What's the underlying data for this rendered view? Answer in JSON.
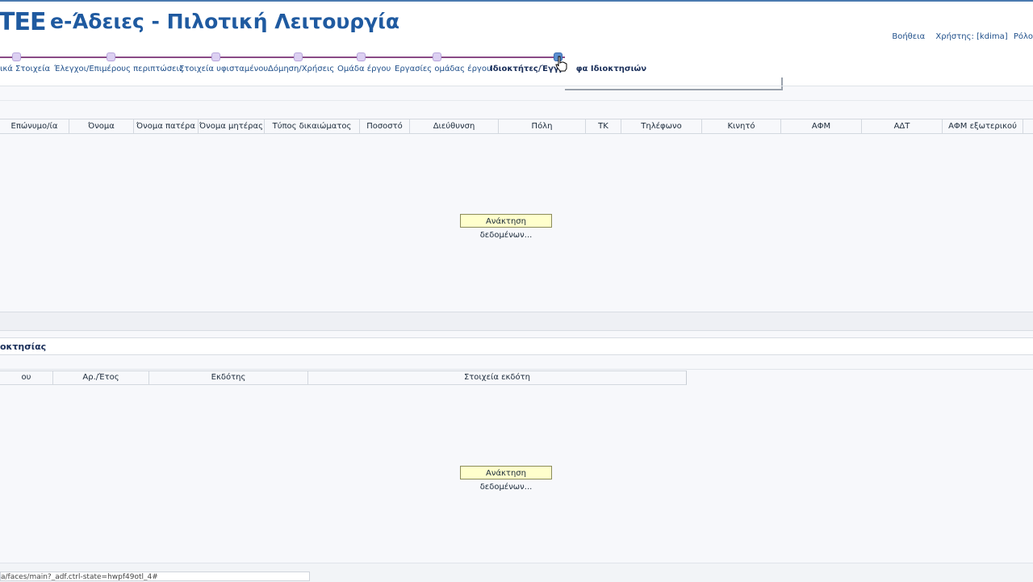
{
  "header": {
    "logo": "ΤΕΕ",
    "title": "e-Άδειες  - Πιλοτική Λειτουργία",
    "help_link": "Βοήθεια",
    "user": "Χρήστης: [kdima]",
    "role": "Ρόλο"
  },
  "train": {
    "stops": [
      {
        "label": "ικά Στοιχεία"
      },
      {
        "label": "Έλεγχοι/Επιμέρους περιπτώσεις"
      },
      {
        "label": "Στοιχεία υφισταμένου"
      },
      {
        "label": "Δόμηση/Χρήσεις"
      },
      {
        "label": "Ομάδα έργου"
      },
      {
        "label": "Εργασίες ομάδας έργου"
      },
      {
        "label": "Ιδιοκτήτες/Έγγρ",
        "label_tail": "φα Ιδιοκτησιών"
      }
    ]
  },
  "owners_table": {
    "columns": [
      "Επώνυμο/ία",
      "Όνομα",
      "Όνομα πατέρα",
      "Όνομα μητέρας",
      "Τύπος δικαιώματος",
      "Ποσοστό",
      "Διεύθυνση",
      "Πόλη",
      "ΤΚ",
      "Τηλέφωνο",
      "Κινητό",
      "ΑΦΜ",
      "ΑΔΤ",
      "ΑΦΜ εξωτερικού"
    ],
    "loading": "Ανάκτηση δεδομένων..."
  },
  "ownership_docs": {
    "title": "οκτησίας",
    "columns": [
      "ου",
      "Αρ./Έτος",
      "Εκδότης",
      "Στοιχεία εκδότη"
    ],
    "loading": "Ανάκτηση δεδομένων..."
  },
  "status_bar": {
    "url": "a/faces/main?_adf.ctrl-state=hwpf49otl_4#"
  },
  "colors": {
    "brand": "#1f5aa0",
    "train_line": "#8a4a86",
    "loading_bg": "#ffffcc"
  }
}
